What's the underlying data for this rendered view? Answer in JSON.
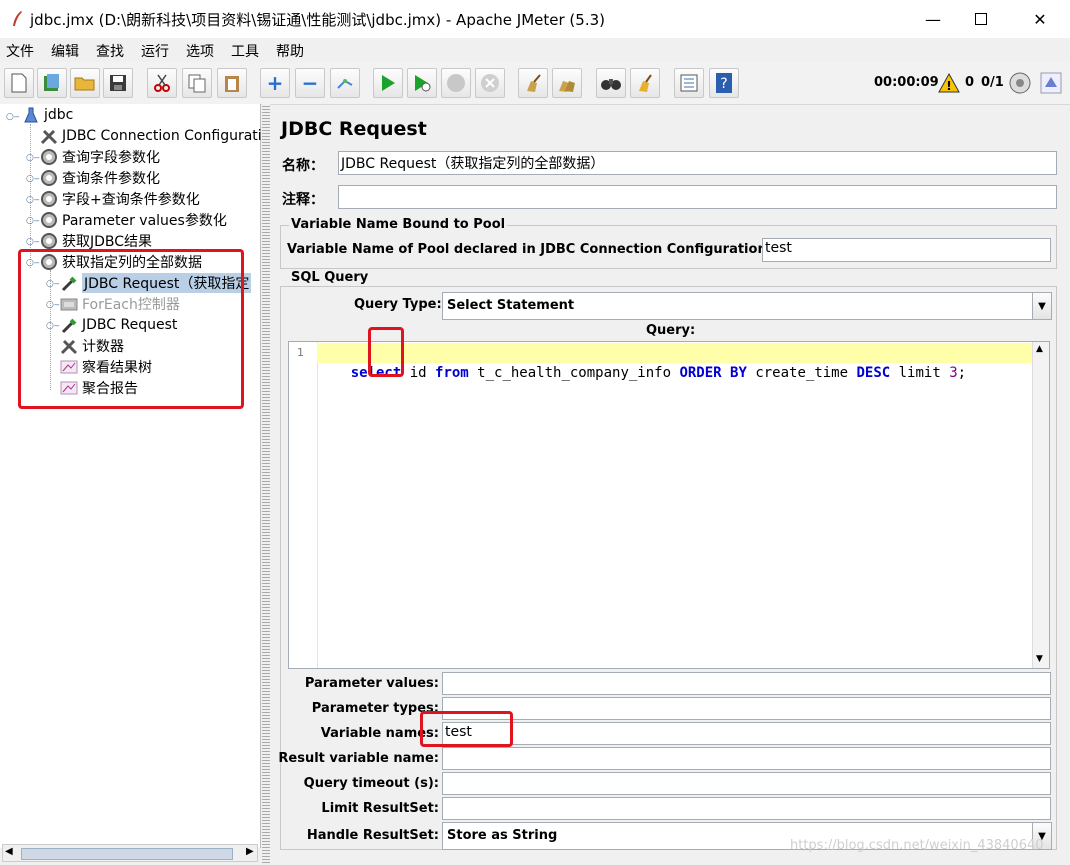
{
  "window": {
    "title": "jdbc.jmx (D:\\朗新科技\\项目资料\\锡证通\\性能测试\\jdbc.jmx) - Apache JMeter (5.3)"
  },
  "menu": [
    "文件",
    "编辑",
    "查找",
    "运行",
    "选项",
    "工具",
    "帮助"
  ],
  "status": {
    "timer": "00:00:09",
    "warnings": "0",
    "threads": "0/1"
  },
  "tree": {
    "root": "jdbc",
    "items": [
      {
        "label": "JDBC Connection Configuratio",
        "icon": "wrench-icon"
      },
      {
        "label": "查询字段参数化",
        "icon": "gear-icon"
      },
      {
        "label": "查询条件参数化",
        "icon": "gear-icon"
      },
      {
        "label": "字段+查询条件参数化",
        "icon": "gear-icon"
      },
      {
        "label": "Parameter values参数化",
        "icon": "gear-icon"
      },
      {
        "label": "获取JDBC结果",
        "icon": "gear-icon"
      },
      {
        "label": "获取指定列的全部数据",
        "icon": "gear-icon"
      },
      {
        "label": "JDBC Request（获取指定",
        "icon": "pipette-icon"
      },
      {
        "label": "ForEach控制器",
        "icon": "controller-icon"
      },
      {
        "label": "JDBC Request",
        "icon": "pipette-icon"
      },
      {
        "label": "计数器",
        "icon": "wrench-icon"
      },
      {
        "label": "察看结果树",
        "icon": "chart-icon"
      },
      {
        "label": "聚合报告",
        "icon": "chart-icon"
      }
    ]
  },
  "panel": {
    "heading": "JDBC Request",
    "name_label": "名称：",
    "name_value": "JDBC Request（获取指定列的全部数据）",
    "comment_label": "注释：",
    "comment_value": "",
    "pool_group": "Variable Name Bound to Pool",
    "pool_label": "Variable Name of Pool declared in JDBC Connection Configuration:",
    "pool_value": "test",
    "sql_group": "SQL Query",
    "query_type_label": "Query Type:",
    "query_type_value": "Select Statement",
    "query_label": "Query:",
    "line_number": "1",
    "code": {
      "t1": "select",
      "t2": " id ",
      "t3": "from",
      "t4": " t_c_health_company_info ",
      "t5": "ORDER BY",
      "t6": " create_time ",
      "t7": "DESC",
      "t8": " limit ",
      "t9": "3",
      "t10": ";"
    },
    "params": [
      {
        "label": "Parameter values:",
        "value": ""
      },
      {
        "label": "Parameter types:",
        "value": ""
      },
      {
        "label": "Variable names:",
        "value": "test"
      },
      {
        "label": "Result variable name:",
        "value": ""
      },
      {
        "label": "Query timeout (s):",
        "value": ""
      },
      {
        "label": "Limit ResultSet:",
        "value": ""
      }
    ],
    "handle_label": "Handle ResultSet:",
    "handle_value": "Store as String"
  },
  "watermark": "https://blog.csdn.net/weixin_43840640"
}
